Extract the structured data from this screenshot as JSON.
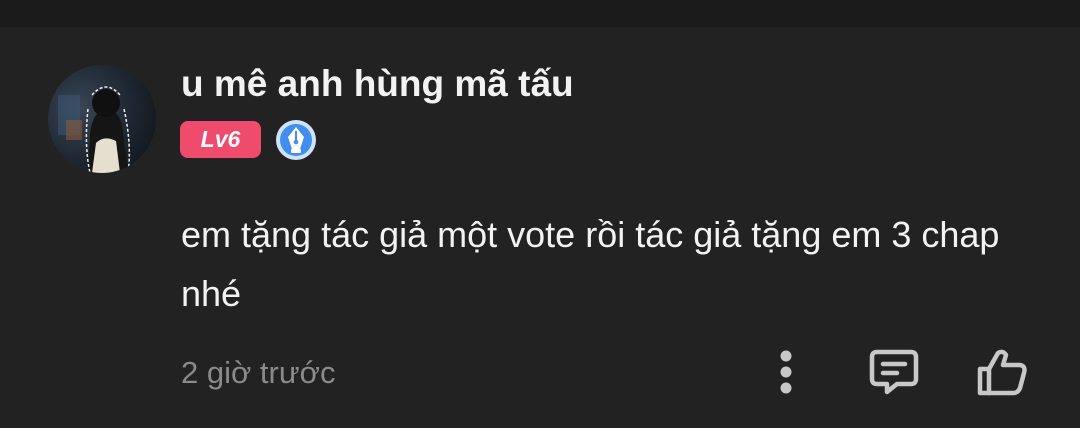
{
  "comment": {
    "username": "u mê anh hùng mã tấu",
    "level_badge": "Lv6",
    "text": "em tặng tác giả một vote rồi tác giả tặng em 3 chap nhé",
    "timestamp": "2 giờ trước"
  },
  "icons": {
    "avatar": "avatar",
    "badge": "pen-nib-badge-icon",
    "more": "more-vertical-icon",
    "reply": "comment-reply-icon",
    "like": "thumbs-up-icon"
  },
  "colors": {
    "background": "#222222",
    "text": "#f2f2f2",
    "muted": "#8a8a8a",
    "level_badge": "#ef4b6c",
    "pen_badge": "#3f8ef0"
  }
}
